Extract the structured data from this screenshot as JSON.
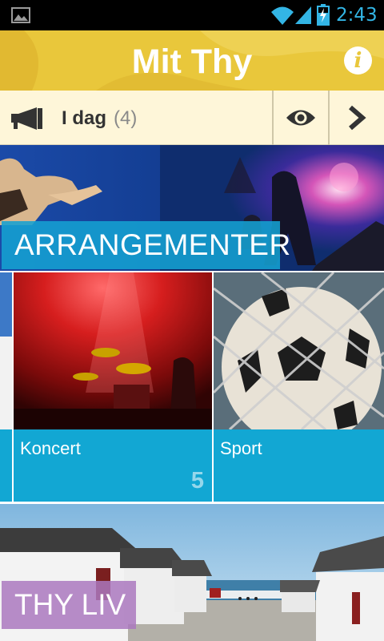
{
  "status_bar": {
    "time": "2:43",
    "icons": [
      "image-notification-icon",
      "wifi-icon",
      "cell-signal-icon",
      "battery-charging-icon"
    ]
  },
  "header": {
    "title": "Mit Thy",
    "info_glyph": "i",
    "color": "#e9c73b"
  },
  "today_bar": {
    "label": "I dag",
    "count": "(4)",
    "icons": [
      "megaphone-icon",
      "eye-icon",
      "chevron-right-icon"
    ]
  },
  "sections": {
    "arrangementer": {
      "label": "ARRANGEMENTER",
      "accent": "#14a0d2"
    },
    "thy_liv": {
      "label": "THY LIV",
      "accent": "#aa78be"
    }
  },
  "categories": [
    {
      "name": "Koncert",
      "count": "5"
    },
    {
      "name": "Sport",
      "count": ""
    }
  ]
}
